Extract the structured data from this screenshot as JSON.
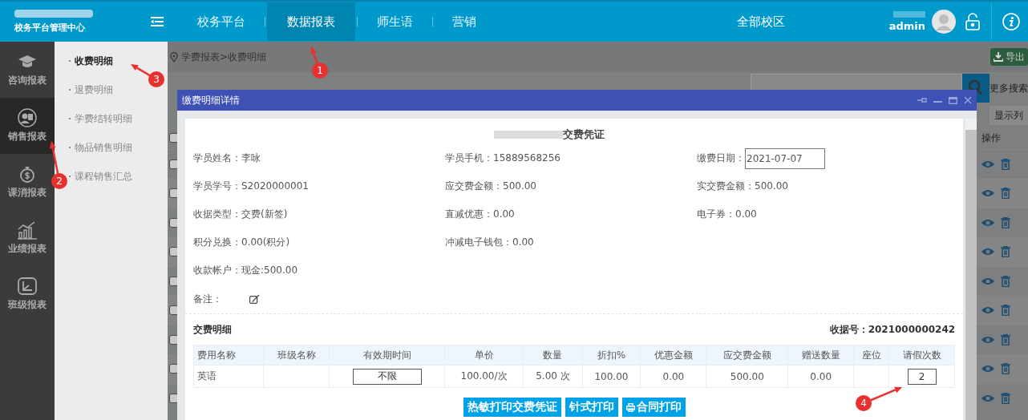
{
  "header": {
    "app_subtitle": "校务平台管理中心",
    "nav": [
      {
        "label": "校务平台",
        "selected": false
      },
      {
        "label": "数据报表",
        "selected": true
      },
      {
        "label": "师生语",
        "selected": false
      },
      {
        "label": "营销",
        "selected": false
      }
    ],
    "campus": "全部校区",
    "user": "admin"
  },
  "sidebar": {
    "items": [
      {
        "label": "咨询报表",
        "selected": false
      },
      {
        "label": "销售报表",
        "selected": true
      },
      {
        "label": "课消报表",
        "selected": false
      },
      {
        "label": "业绩报表",
        "selected": false
      },
      {
        "label": "班级报表",
        "selected": false
      }
    ]
  },
  "list": {
    "header_checked": false,
    "rows": [
      {
        "checked": false
      },
      {
        "checked": false
      },
      {
        "checked": false
      },
      {
        "checked": false
      },
      {
        "checked": false
      },
      {
        "checked": false
      },
      {
        "checked": false
      },
      {
        "checked": false
      },
      {
        "checked": false
      }
    ]
  },
  "submenu": {
    "items": [
      {
        "label": "收费明细",
        "selected": true
      },
      {
        "label": "退费明细",
        "selected": false
      },
      {
        "label": "学费结转明细",
        "selected": false
      },
      {
        "label": "物品销售明细",
        "selected": false
      },
      {
        "label": "课程销售汇总",
        "selected": false
      }
    ]
  },
  "breadcrumb": "学费报表>收费明细",
  "toolbar": {
    "export": "导出",
    "more_search": "更多搜索",
    "columns": "显示列",
    "actions_header": "操作"
  },
  "dialog": {
    "title": "缴费明细详情",
    "voucher_title": "交费凭证",
    "fields": [
      {
        "label": "学员姓名：",
        "value": "李咏"
      },
      {
        "label": "学员手机：",
        "value": "15889568256"
      },
      {
        "label": "缴费日期：",
        "value": "2021-07-07",
        "kind": "input"
      },
      {
        "label": "学员学号：",
        "value": "S2020000001"
      },
      {
        "label": "应交费金额：",
        "value": "500.00"
      },
      {
        "label": "实交费金额：",
        "value": "500.00"
      },
      {
        "label": "收据类型：",
        "value": "交费(新签)"
      },
      {
        "label": "直减优惠：",
        "value": "0.00"
      },
      {
        "label": "电子券：",
        "value": "0.00"
      },
      {
        "label": "积分兑换：",
        "value": "0.00(积分)"
      },
      {
        "label": "冲减电子钱包：",
        "value": "0.00"
      },
      {
        "kind": "empty"
      },
      {
        "label": "收款帐户：",
        "value": "现金:500.00"
      }
    ],
    "remark_label": "备注：",
    "detail_title": "交费明细",
    "receipt_label": "收据号：",
    "receipt_no": "2021000000242",
    "table": {
      "columns": [
        "费用名称",
        "班级名称",
        "有效期时间",
        "单价",
        "数量",
        "折扣%",
        "优惠金额",
        "应交费金额",
        "赠送数量",
        "座位",
        "请假次数"
      ],
      "rows": [
        [
          {
            "text": "英语"
          },
          {
            "text": ""
          },
          {
            "text": "不限",
            "kind": "input"
          },
          {
            "text": "100.00/次"
          },
          {
            "text": "5.00 次"
          },
          {
            "text": "100.00"
          },
          {
            "text": "0.00"
          },
          {
            "text": "500.00"
          },
          {
            "text": "0.00"
          },
          {
            "text": ""
          },
          {
            "text": "2",
            "kind": "input"
          }
        ]
      ]
    },
    "buttons": [
      "热敏打印交费凭证",
      "针式打印",
      "合同打印"
    ]
  },
  "annotations": [
    {
      "label": "1"
    },
    {
      "label": "2"
    },
    {
      "label": "3"
    },
    {
      "label": "4"
    }
  ]
}
